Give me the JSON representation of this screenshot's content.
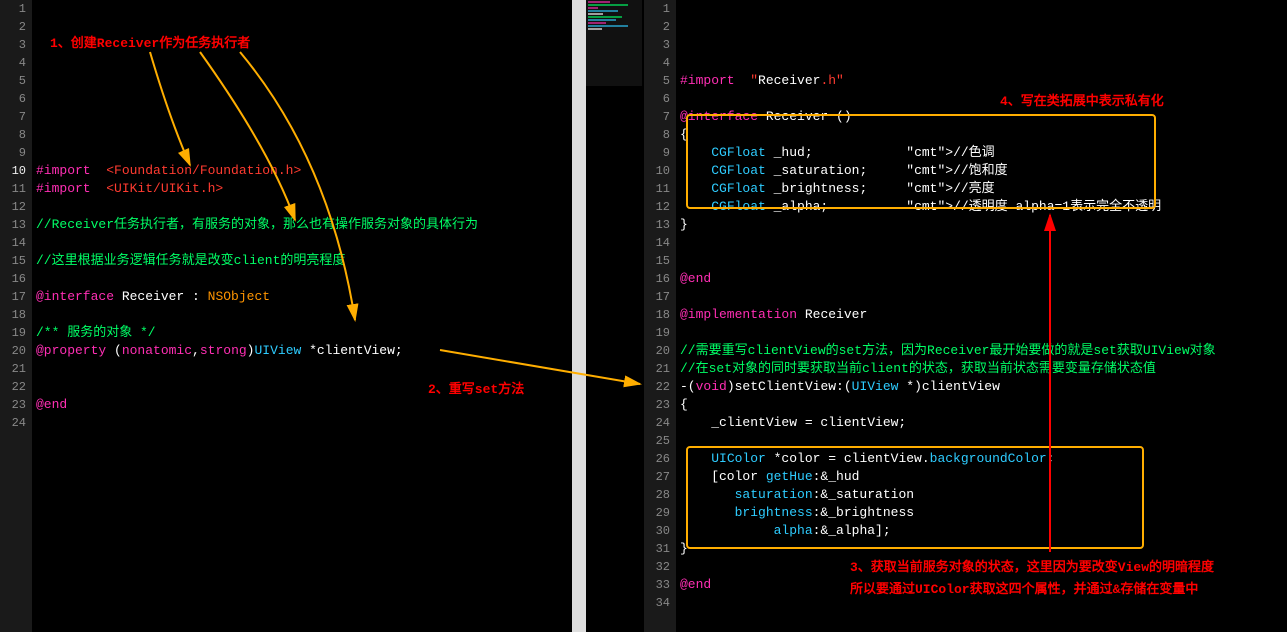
{
  "left": {
    "lines": [
      "",
      "",
      "",
      "",
      "",
      "",
      "",
      "",
      "",
      "#import  <Foundation/Foundation.h>",
      "#import  <UIKit/UIKit.h>",
      "",
      "//Receiver任务执行者，有服务的对象，那么也有操作服务对象的具体行为",
      "",
      "//这里根据业务逻辑任务就是改变client的明亮程度",
      "",
      "@interface Receiver : NSObject",
      "",
      "/** 服务的对象 */",
      "@property (nonatomic,strong)UIView *clientView;",
      "",
      "",
      "@end",
      ""
    ],
    "start": 1
  },
  "right": {
    "lines": [
      "",
      "",
      "",
      "",
      "#import  \"Receiver.h\"",
      "",
      "@interface Receiver ()",
      "{",
      "    CGFloat _hud;            //色调",
      "    CGFloat _saturation;     //饱和度",
      "    CGFloat _brightness;     //亮度",
      "    CGFloat _alpha;          //透明度 alpha=1表示完全不透明",
      "}",
      "",
      "",
      "@end",
      "",
      "@implementation Receiver",
      "",
      "//需要重写clientView的set方法，因为Receiver最开始要做的就是set获取UIView对象",
      "//在set对象的同时要获取当前client的状态，获取当前状态需要变量存储状态值",
      "-(void)setClientView:(UIView *)clientView",
      "{",
      "    _clientView = clientView;",
      "",
      "    UIColor *color = clientView.backgroundColor;",
      "    [color getHue:&_hud",
      "       saturation:&_saturation",
      "       brightness:&_brightness",
      "            alpha:&_alpha];",
      "}",
      "",
      "@end",
      ""
    ],
    "start": 1
  },
  "annotations": {
    "a1": "1、创建Receiver作为任务执行者",
    "a2": "2、重写set方法",
    "a3a": "3、获取当前服务对象的状态，这里因为要改变View的明暗程度",
    "a3b": "所以要通过UIColor获取这四个属性，并通过&存储在变量中",
    "a4": "4、写在类拓展中表示私有化"
  }
}
